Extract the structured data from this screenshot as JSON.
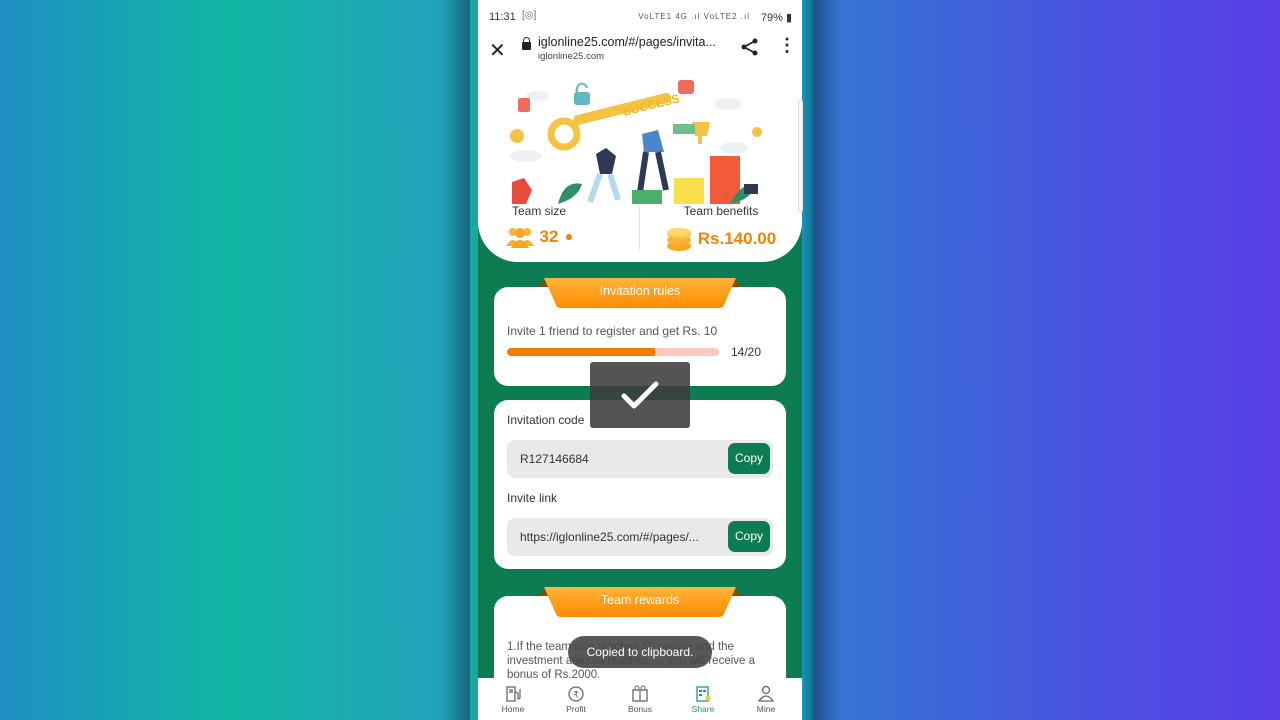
{
  "status_bar": {
    "time": "11:31",
    "signal": "VoLTE1 4G .ıl VoLTE2 .ıl",
    "battery": "79%"
  },
  "browser": {
    "url": "iglonline25.com/#/pages/invita...",
    "domain": "iglonline25.com"
  },
  "hero": {
    "illustration_text": "SUCCESS"
  },
  "stats": {
    "team_size_label": "Team size",
    "team_size_value": "32",
    "team_benefits_label": "Team benefits",
    "team_benefits_value": "Rs.140.00"
  },
  "invitation_rules": {
    "title": "Invitation rules",
    "rule_text": "Invite 1 friend to register and get Rs. 10",
    "progress_current": 14,
    "progress_total": 20,
    "progress_label": "14/20"
  },
  "invitation": {
    "code_label": "Invitation code",
    "code_value": "R127146684",
    "link_label": "Invite link",
    "link_value": "https://iglonline25.com/#/pages/...",
    "copy_label": "Copy"
  },
  "team_rewards": {
    "title": "Team rewards",
    "text": "1.If the team size reaches 50 people and the investment amount reaches ..., you will receive a bonus of Rs.2000."
  },
  "toast": {
    "message": "Copied to clipboard."
  },
  "bottom_nav": {
    "items": [
      {
        "label": "Home",
        "icon": "fuel-pump-icon"
      },
      {
        "label": "Profit",
        "icon": "rupee-icon"
      },
      {
        "label": "Bonus",
        "icon": "gift-box-icon"
      },
      {
        "label": "Share",
        "icon": "share-doc-icon",
        "active": true
      },
      {
        "label": "Mine",
        "icon": "user-icon"
      }
    ]
  },
  "colors": {
    "brand_green": "#0d7c53",
    "accent_orange": "#f08400",
    "active_nav": "#1a9a6d"
  }
}
